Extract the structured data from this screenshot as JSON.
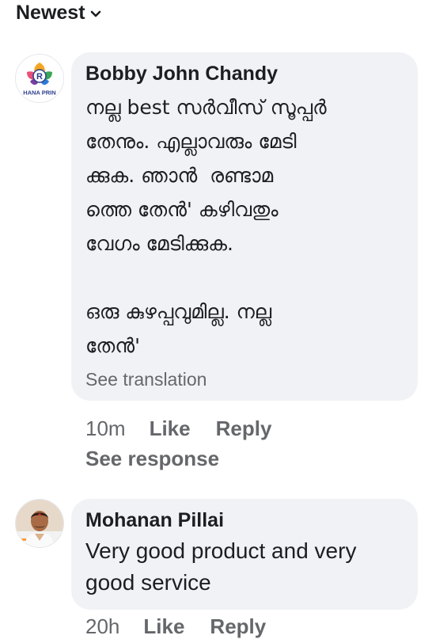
{
  "sort": {
    "label": "Newest"
  },
  "comments": [
    {
      "author": "Bobby John Chandy",
      "avatar_text": "HANA PRIN",
      "avatar_letters": "R",
      "text": "നല്ല best സർവീസ് സൂപ്പർ\nതേനും. എല്ലാവരും മേടി\nക്കുക. ഞാൻ  രണ്ടാമ\nത്തെ തേൻ' കഴിവതും\nവേഗം മേടിക്കുക.\n\nഒരു കുഴപ്പവുമില്ല. നല്ല\nതേൻ'",
      "see_translation": "See translation",
      "time": "10m",
      "like": "Like",
      "reply": "Reply",
      "see_response": "See response"
    },
    {
      "author": "Mohanan Pillai",
      "text": "Very good product and very\ngood service",
      "time": "20h",
      "like": "Like",
      "reply": "Reply"
    }
  ]
}
